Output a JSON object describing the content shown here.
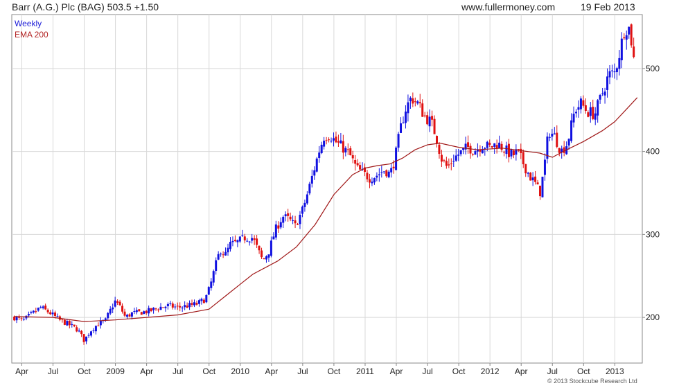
{
  "header": {
    "title": "Barr (A.G.) Plc (BAG) 503.5 +1.50",
    "website": "www.fullermoney.com",
    "date": "19 Feb 2013"
  },
  "legend": {
    "weekly": "Weekly",
    "ema": "EMA 200"
  },
  "copyright": "© 2013 Stockcube Research Ltd",
  "colors": {
    "up": "#1010e0",
    "down": "#e01010",
    "ema": "#a01818",
    "grid": "#d8d8d8",
    "frame": "#888888"
  },
  "chart_data": {
    "type": "line",
    "ylim": [
      145,
      565
    ],
    "xlim": [
      2008.17,
      2013.22
    ],
    "grid": true,
    "y_ticks": [
      200,
      300,
      400,
      500
    ],
    "x_ticks": [
      {
        "x": 2008.25,
        "label": "Apr"
      },
      {
        "x": 2008.5,
        "label": "Jul"
      },
      {
        "x": 2008.75,
        "label": "Oct"
      },
      {
        "x": 2009.0,
        "label": "2009"
      },
      {
        "x": 2009.25,
        "label": "Apr"
      },
      {
        "x": 2009.5,
        "label": "Jul"
      },
      {
        "x": 2009.75,
        "label": "Oct"
      },
      {
        "x": 2010.0,
        "label": "2010"
      },
      {
        "x": 2010.25,
        "label": "Apr"
      },
      {
        "x": 2010.5,
        "label": "Jul"
      },
      {
        "x": 2010.75,
        "label": "Oct"
      },
      {
        "x": 2011.0,
        "label": "2011"
      },
      {
        "x": 2011.25,
        "label": "Apr"
      },
      {
        "x": 2011.5,
        "label": "Jul"
      },
      {
        "x": 2011.75,
        "label": "Oct"
      },
      {
        "x": 2012.0,
        "label": "2012"
      },
      {
        "x": 2012.25,
        "label": "Apr"
      },
      {
        "x": 2012.5,
        "label": "Jul"
      },
      {
        "x": 2012.75,
        "label": "Oct"
      },
      {
        "x": 2013.0,
        "label": "2013"
      }
    ],
    "series": [
      {
        "name": "Weekly",
        "style": "price-bars",
        "points": [
          [
            2008.19,
            200
          ],
          [
            2008.26,
            196
          ],
          [
            2008.33,
            204
          ],
          [
            2008.4,
            212
          ],
          [
            2008.48,
            205
          ],
          [
            2008.55,
            197
          ],
          [
            2008.62,
            192
          ],
          [
            2008.7,
            185
          ],
          [
            2008.75,
            172
          ],
          [
            2008.8,
            184
          ],
          [
            2008.86,
            192
          ],
          [
            2008.92,
            196
          ],
          [
            2008.97,
            212
          ],
          [
            2009.0,
            220
          ],
          [
            2009.04,
            212
          ],
          [
            2009.08,
            200
          ],
          [
            2009.13,
            205
          ],
          [
            2009.2,
            206
          ],
          [
            2009.28,
            208
          ],
          [
            2009.35,
            212
          ],
          [
            2009.42,
            214
          ],
          [
            2009.5,
            212
          ],
          [
            2009.58,
            214
          ],
          [
            2009.65,
            216
          ],
          [
            2009.72,
            222
          ],
          [
            2009.76,
            238
          ],
          [
            2009.8,
            262
          ],
          [
            2009.84,
            282
          ],
          [
            2009.88,
            275
          ],
          [
            2009.92,
            288
          ],
          [
            2009.97,
            290
          ],
          [
            2010.03,
            296
          ],
          [
            2010.1,
            296
          ],
          [
            2010.14,
            282
          ],
          [
            2010.18,
            268
          ],
          [
            2010.23,
            280
          ],
          [
            2010.28,
            305
          ],
          [
            2010.34,
            322
          ],
          [
            2010.39,
            318
          ],
          [
            2010.44,
            310
          ],
          [
            2010.5,
            330
          ],
          [
            2010.54,
            350
          ],
          [
            2010.58,
            372
          ],
          [
            2010.63,
            400
          ],
          [
            2010.67,
            418
          ],
          [
            2010.72,
            420
          ],
          [
            2010.76,
            412
          ],
          [
            2010.82,
            405
          ],
          [
            2010.88,
            395
          ],
          [
            2010.93,
            380
          ],
          [
            2010.98,
            374
          ],
          [
            2011.04,
            368
          ],
          [
            2011.1,
            372
          ],
          [
            2011.16,
            378
          ],
          [
            2011.2,
            372
          ],
          [
            2011.24,
            392
          ],
          [
            2011.28,
            425
          ],
          [
            2011.32,
            450
          ],
          [
            2011.37,
            465
          ],
          [
            2011.42,
            458
          ],
          [
            2011.48,
            442
          ],
          [
            2011.53,
            435
          ],
          [
            2011.57,
            418
          ],
          [
            2011.61,
            392
          ],
          [
            2011.66,
            380
          ],
          [
            2011.71,
            392
          ],
          [
            2011.76,
            398
          ],
          [
            2011.82,
            405
          ],
          [
            2011.88,
            402
          ],
          [
            2011.94,
            408
          ],
          [
            2012.0,
            405
          ],
          [
            2012.06,
            410
          ],
          [
            2012.12,
            402
          ],
          [
            2012.18,
            395
          ],
          [
            2012.22,
            400
          ],
          [
            2012.27,
            385
          ],
          [
            2012.32,
            370
          ],
          [
            2012.36,
            362
          ],
          [
            2012.4,
            350
          ],
          [
            2012.43,
            375
          ],
          [
            2012.47,
            425
          ],
          [
            2012.52,
            418
          ],
          [
            2012.57,
            400
          ],
          [
            2012.62,
            410
          ],
          [
            2012.68,
            450
          ],
          [
            2012.73,
            458
          ],
          [
            2012.78,
            448
          ],
          [
            2012.84,
            445
          ],
          [
            2012.9,
            470
          ],
          [
            2012.95,
            492
          ],
          [
            2013.0,
            495
          ],
          [
            2013.04,
            520
          ],
          [
            2013.08,
            550
          ],
          [
            2013.12,
            548
          ],
          [
            2013.15,
            512
          ],
          [
            2013.17,
            503.5
          ]
        ]
      },
      {
        "name": "EMA 200",
        "style": "line",
        "points": [
          [
            2008.19,
            201
          ],
          [
            2008.5,
            200
          ],
          [
            2008.75,
            195
          ],
          [
            2009.0,
            197
          ],
          [
            2009.25,
            200
          ],
          [
            2009.5,
            203
          ],
          [
            2009.75,
            210
          ],
          [
            2009.9,
            228
          ],
          [
            2010.0,
            240
          ],
          [
            2010.1,
            252
          ],
          [
            2010.2,
            260
          ],
          [
            2010.3,
            268
          ],
          [
            2010.45,
            285
          ],
          [
            2010.6,
            312
          ],
          [
            2010.75,
            348
          ],
          [
            2010.9,
            372
          ],
          [
            2011.0,
            380
          ],
          [
            2011.1,
            383
          ],
          [
            2011.2,
            385
          ],
          [
            2011.3,
            392
          ],
          [
            2011.4,
            402
          ],
          [
            2011.5,
            408
          ],
          [
            2011.6,
            410
          ],
          [
            2011.75,
            405
          ],
          [
            2011.9,
            402
          ],
          [
            2012.1,
            404
          ],
          [
            2012.3,
            400
          ],
          [
            2012.4,
            398
          ],
          [
            2012.5,
            393
          ],
          [
            2012.6,
            401
          ],
          [
            2012.75,
            412
          ],
          [
            2012.9,
            425
          ],
          [
            2013.0,
            436
          ],
          [
            2013.1,
            452
          ],
          [
            2013.18,
            465
          ]
        ]
      }
    ]
  }
}
